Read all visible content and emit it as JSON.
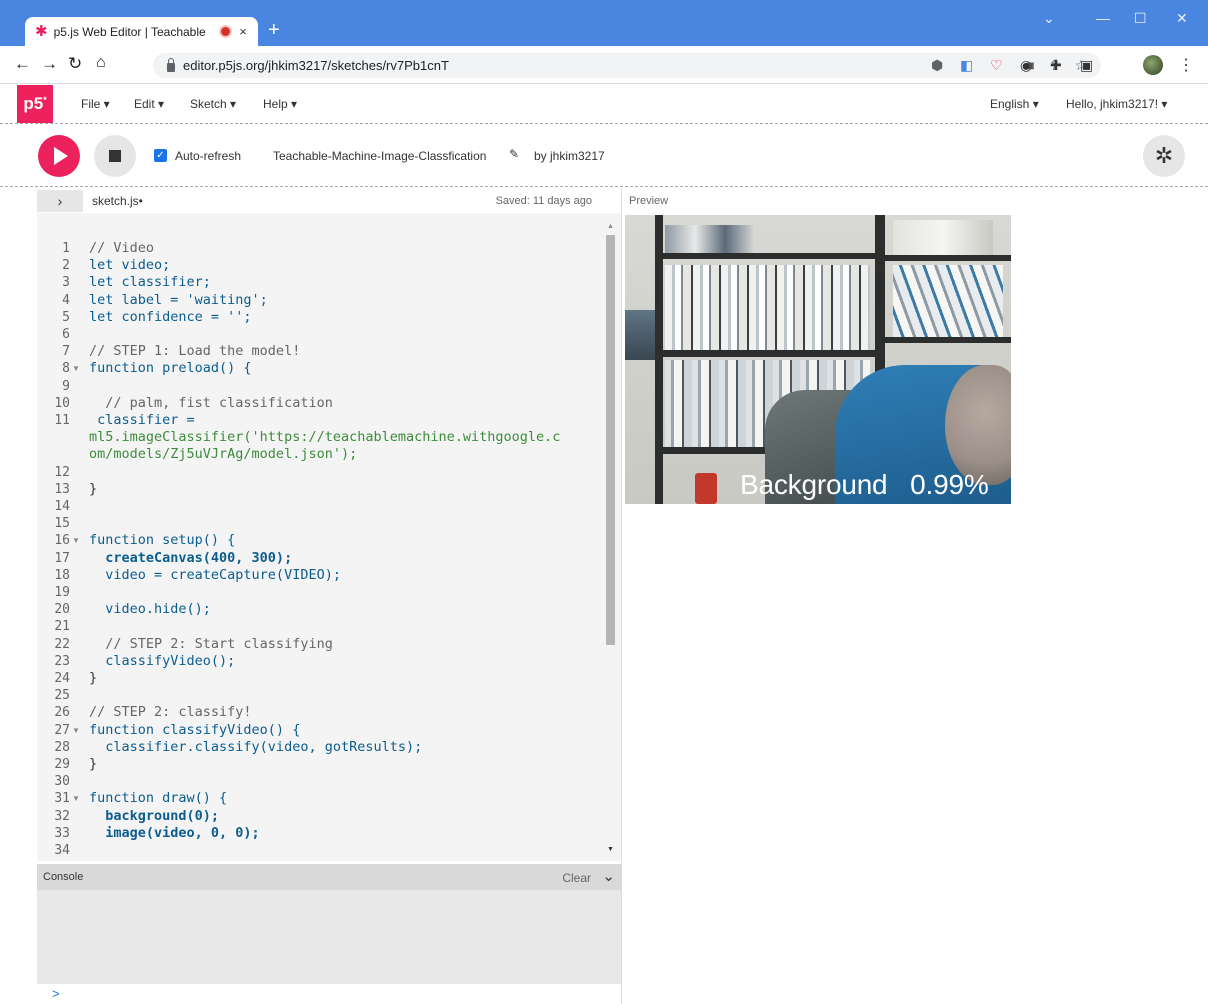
{
  "browser": {
    "tab_title": "p5.js Web Editor | Teachable",
    "tab_close": "×",
    "new_tab": "+",
    "url": "editor.p5js.org/jhkim3217/sketches/rv7Pb1cnT",
    "window_controls": {
      "chevron": "⌄",
      "minimize": "—",
      "maximize": "☐",
      "close": "✕"
    }
  },
  "nav": {
    "logo": "p5",
    "logo_sup": "*",
    "menus": [
      "File ▾",
      "Edit ▾",
      "Sketch ▾",
      "Help ▾"
    ],
    "language": "English ▾",
    "user": "Hello, jhkim3217! ▾"
  },
  "toolbar": {
    "auto_refresh_label": "Auto-refresh",
    "auto_refresh_checked": true,
    "sketch_name": "Teachable-Machine-Image-Classfication",
    "by_user": "by jhkim3217"
  },
  "editor": {
    "filename": "sketch.js•",
    "saved": "Saved: 11 days ago",
    "preview_label": "Preview",
    "lines": [
      {
        "n": "1",
        "code": "// Video"
      },
      {
        "n": "2",
        "code": "let video;"
      },
      {
        "n": "3",
        "code": "let classifier;"
      },
      {
        "n": "4",
        "code": "let label = 'waiting';"
      },
      {
        "n": "5",
        "code": "let confidence = '';"
      },
      {
        "n": "6",
        "code": ""
      },
      {
        "n": "7",
        "code": "// STEP 1: Load the model!"
      },
      {
        "n": "8",
        "code": "function preload() {"
      },
      {
        "n": "9",
        "code": ""
      },
      {
        "n": "10",
        "code": "  // palm, fist classification"
      },
      {
        "n": "11",
        "code": " classifier ="
      },
      {
        "n": "",
        "code": "ml5.imageClassifier('https://teachablemachine.withgoogle.c"
      },
      {
        "n": "",
        "code": "om/models/Zj5uVJrAg/model.json');"
      },
      {
        "n": "12",
        "code": ""
      },
      {
        "n": "13",
        "code": "}"
      },
      {
        "n": "14",
        "code": ""
      },
      {
        "n": "15",
        "code": ""
      },
      {
        "n": "16",
        "code": "function setup() {"
      },
      {
        "n": "17",
        "code": "  createCanvas(400, 300);"
      },
      {
        "n": "18",
        "code": "  video = createCapture(VIDEO);"
      },
      {
        "n": "19",
        "code": ""
      },
      {
        "n": "20",
        "code": "  video.hide();"
      },
      {
        "n": "21",
        "code": ""
      },
      {
        "n": "22",
        "code": "  // STEP 2: Start classifying"
      },
      {
        "n": "23",
        "code": "  classifyVideo();"
      },
      {
        "n": "24",
        "code": "}"
      },
      {
        "n": "25",
        "code": ""
      },
      {
        "n": "26",
        "code": "// STEP 2: classify!"
      },
      {
        "n": "27",
        "code": "function classifyVideo() {"
      },
      {
        "n": "28",
        "code": "  classifier.classify(video, gotResults);"
      },
      {
        "n": "29",
        "code": "}"
      },
      {
        "n": "30",
        "code": ""
      },
      {
        "n": "31",
        "code": "function draw() {"
      },
      {
        "n": "32",
        "code": "  background(0);"
      },
      {
        "n": "33",
        "code": "  image(video, 0, 0);"
      },
      {
        "n": "34",
        "code": ""
      }
    ]
  },
  "console": {
    "label": "Console",
    "clear": "Clear",
    "prompt": ">"
  },
  "preview": {
    "overlay_text": "Background   0.99%"
  },
  "colors": {
    "p5_pink": "#ed225d",
    "chrome_blue": "#4a86e0"
  }
}
